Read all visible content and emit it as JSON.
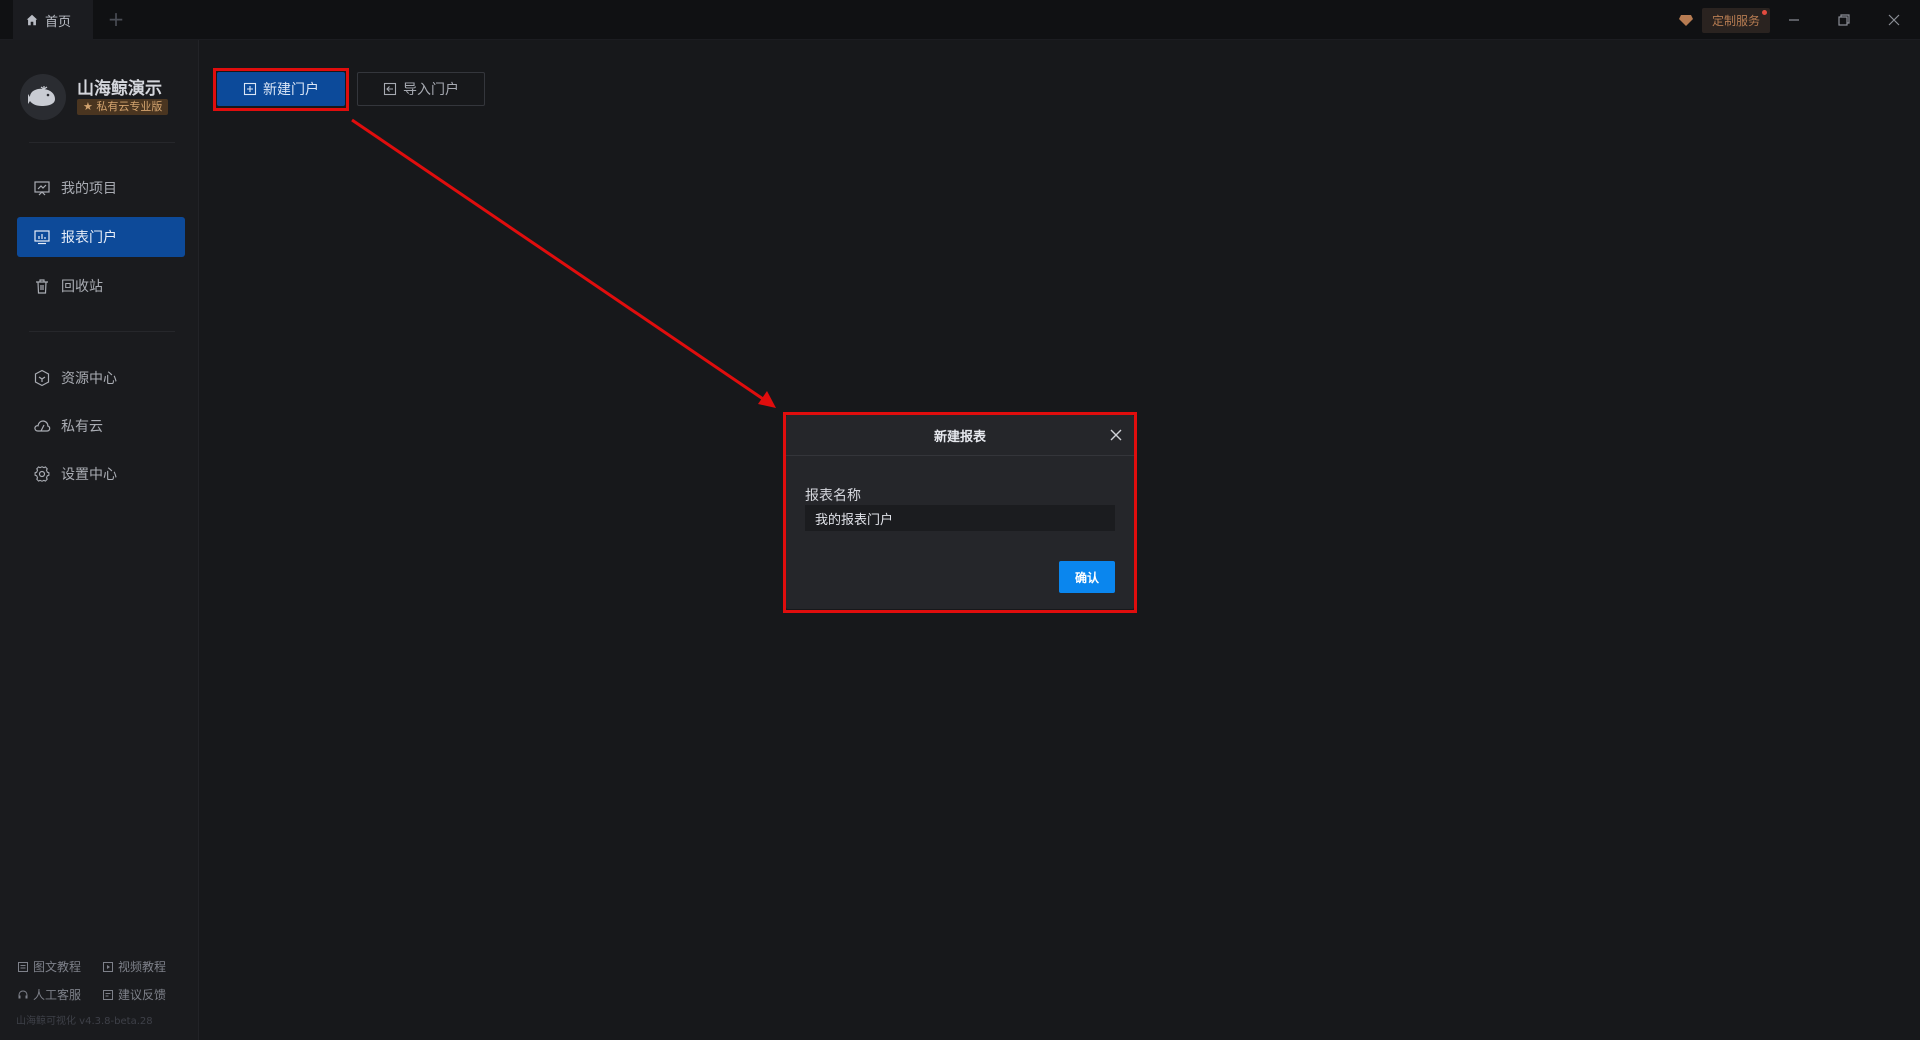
{
  "titlebar": {
    "home_tab_label": "首页",
    "add_tab_symbol": "+",
    "service_label": "定制服务"
  },
  "sidebar": {
    "brand_name": "山海鲸演示",
    "edition_badge": "★ 私有云专业版",
    "nav_primary": [
      {
        "label": "我的项目",
        "icon": "chart-board-icon"
      },
      {
        "label": "报表门户",
        "icon": "report-portal-icon",
        "active": true
      },
      {
        "label": "回收站",
        "icon": "trash-icon"
      }
    ],
    "nav_secondary": [
      {
        "label": "资源中心",
        "icon": "hexagon-icon"
      },
      {
        "label": "私有云",
        "icon": "cloud-icon"
      },
      {
        "label": "设置中心",
        "icon": "gear-icon"
      }
    ],
    "footer_links": [
      {
        "label": "图文教程",
        "icon": "doc-icon"
      },
      {
        "label": "视频教程",
        "icon": "video-icon"
      },
      {
        "label": "人工客服",
        "icon": "headset-icon"
      },
      {
        "label": "建议反馈",
        "icon": "feedback-icon"
      }
    ],
    "version": "山海鲸可视化 v4.3.8-beta.28"
  },
  "toolbar": {
    "new_portal_label": "新建门户",
    "import_portal_label": "导入门户"
  },
  "dialog": {
    "title": "新建报表",
    "field_label": "报表名称",
    "field_value": "我的报表门户",
    "confirm_label": "确认"
  },
  "colors": {
    "accent_blue": "#0c4a9a",
    "confirm_blue": "#0a86ee",
    "annotation_red": "#e00d0d",
    "background": "#17181b"
  }
}
